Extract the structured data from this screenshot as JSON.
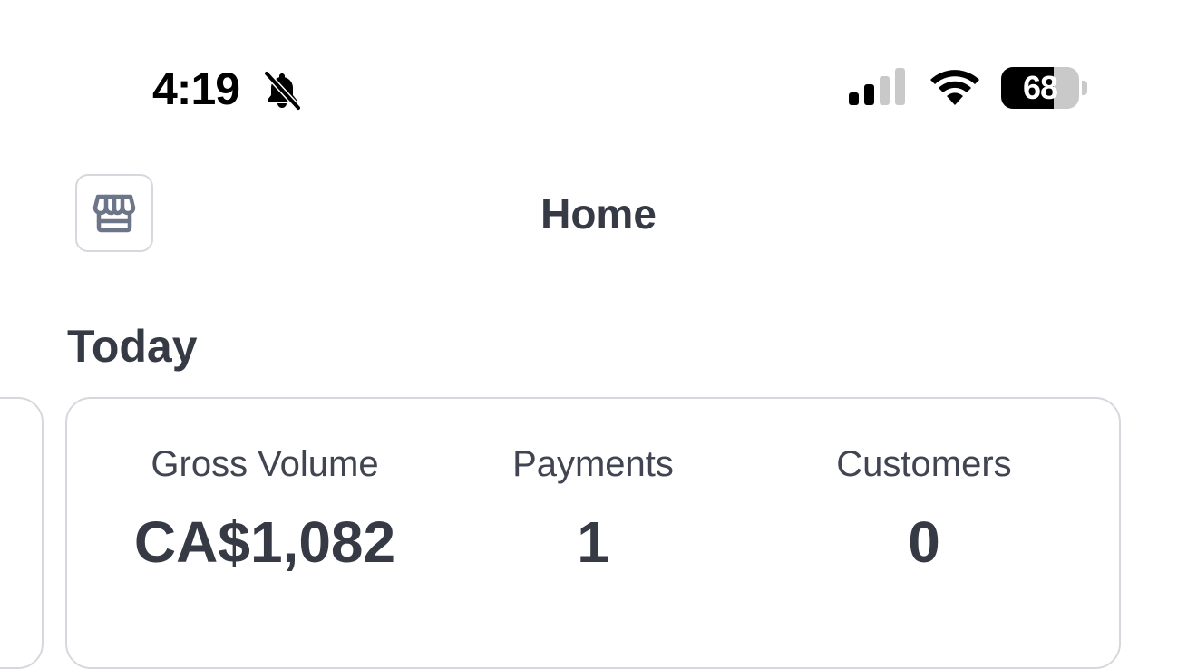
{
  "status_bar": {
    "time": "4:19",
    "battery_level": "68",
    "battery_fraction": 0.68,
    "signal_bars_active": 2,
    "signal_bars_total": 4
  },
  "header": {
    "title": "Home",
    "store_icon": "storefront-icon"
  },
  "today": {
    "title": "Today",
    "stats": [
      {
        "label": "Gross Volume",
        "value": "CA$1,082"
      },
      {
        "label": "Payments",
        "value": "1"
      },
      {
        "label": "Customers",
        "value": "0"
      }
    ]
  },
  "colors": {
    "text_primary": "#353a44",
    "border": "#d5d8dd",
    "icon": "#6c7688"
  }
}
